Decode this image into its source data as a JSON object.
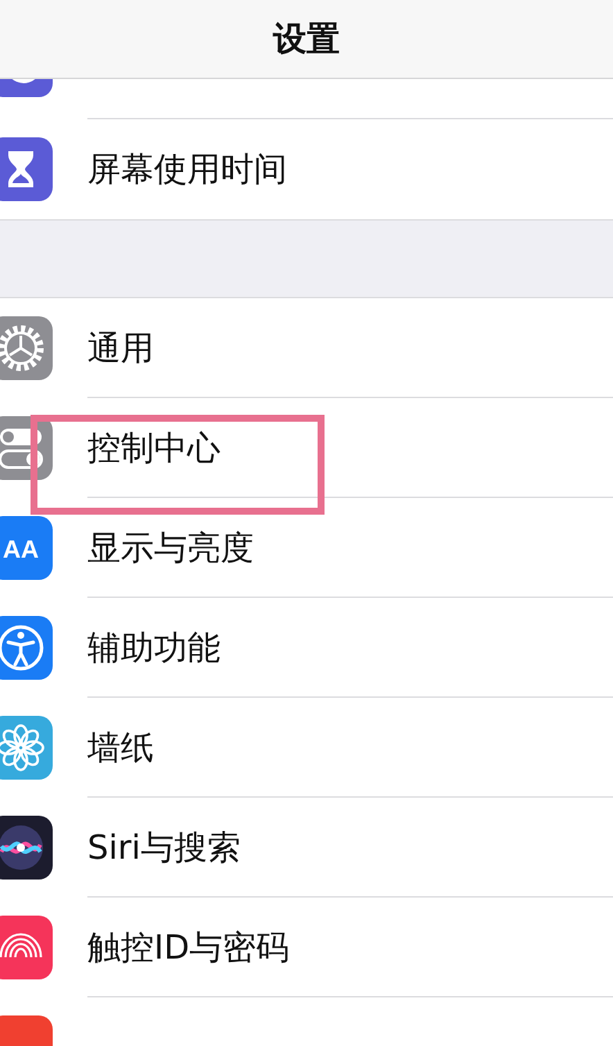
{
  "nav_bar": {
    "title": "设置"
  },
  "sections": [
    {
      "items": [
        {
          "kind": "moon",
          "color": "#5b5bd6",
          "partial": true
        },
        {
          "kind": "hourglass",
          "color": "#5b5bd6",
          "label": "屏幕使用时间"
        }
      ]
    },
    {
      "items": [
        {
          "kind": "gear",
          "color": "#8e8e93",
          "label": "通用"
        },
        {
          "kind": "switches",
          "color": "#8e8e93",
          "label": "控制中心",
          "highlighted": true
        },
        {
          "kind": "letters",
          "color": "#1a7cf5",
          "label": "显示与亮度",
          "badge": "AA"
        },
        {
          "kind": "accessibility",
          "color": "#1a7cf5",
          "label": "辅助功能"
        },
        {
          "kind": "flower",
          "color": "#36aadd",
          "label": "墙纸"
        },
        {
          "kind": "siri",
          "color": "#1c1c2e",
          "label": "Siri与搜索"
        },
        {
          "kind": "fingerprint",
          "color": "#f5345a",
          "label": "触控ID与密码"
        },
        {
          "kind": "letters",
          "color": "#f04030"
        }
      ]
    }
  ]
}
